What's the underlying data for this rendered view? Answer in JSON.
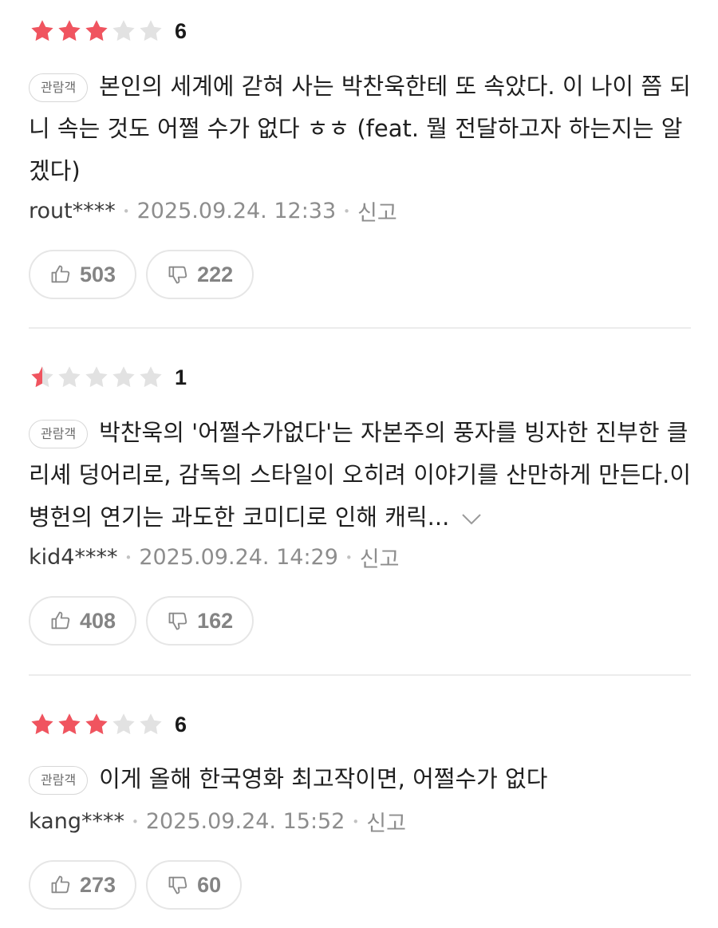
{
  "colors": {
    "star_filled": "#f0545f",
    "star_empty": "#e2e2e2"
  },
  "reviews": [
    {
      "rating": 3,
      "score": "6",
      "badge": "관람객",
      "text": "본인의 세계에 갇혀 사는 박찬욱한테 또 속았다. 이 나이 쯤 되니 속는 것도 어쩔 수가 없다 ㅎㅎ (feat. 뭘 전달하고자 하는지는 알겠다)",
      "user": "rout****",
      "date": "2025.09.24. 12:33",
      "report": "신고",
      "likes": "503",
      "dislikes": "222"
    },
    {
      "rating": 0.5,
      "score": "1",
      "badge": "관람객",
      "text": "박찬욱의 '어쩔수가없다'는 자본주의 풍자를 빙자한 진부한 클리셰 덩어리로, 감독의 스타일이 오히려 이야기를 산만하게 만든다.이병헌의 연기는 과도한 코미디로 인해 캐릭...",
      "user": "kid4****",
      "date": "2025.09.24. 14:29",
      "report": "신고",
      "likes": "408",
      "dislikes": "162"
    },
    {
      "rating": 3,
      "score": "6",
      "badge": "관람객",
      "text": "이게 올해 한국영화 최고작이면, 어쩔수가 없다",
      "user": "kang****",
      "date": "2025.09.24. 15:52",
      "report": "신고",
      "likes": "273",
      "dislikes": "60"
    }
  ]
}
